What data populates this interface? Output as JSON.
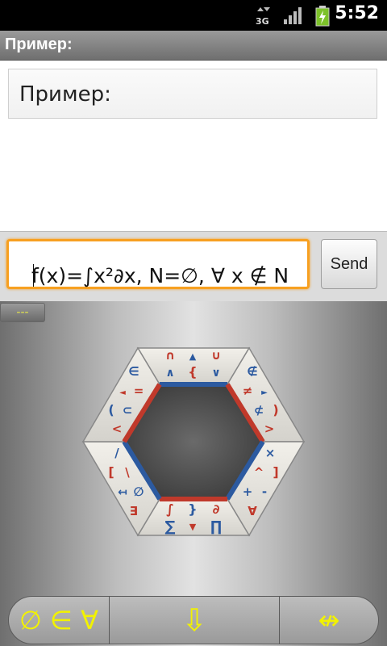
{
  "status_bar": {
    "network": "3G",
    "time": "5:52",
    "icons": [
      "network-3g-icon",
      "signal-icon",
      "battery-charging-icon"
    ]
  },
  "title_bar": {
    "title": "Пример:"
  },
  "preview": {
    "text": "Пример:"
  },
  "input": {
    "value": "f(x)=∫x²∂x, N=∅,  ∀ x ∉ N"
  },
  "send_button": {
    "label": "Send"
  },
  "mode_button": {
    "label": "---"
  },
  "hex_keys": {
    "top": [
      "∩",
      "▲",
      "∪",
      "∧",
      "{",
      "∨"
    ],
    "upper_right": [
      "∉",
      "≠",
      "►",
      "⊄",
      ")",
      ">"
    ],
    "lower_right": [
      "×",
      "^",
      "]",
      "+",
      "-",
      "∀"
    ],
    "bottom": [
      "∫",
      "}",
      "∂",
      "∑",
      "▼",
      "∏"
    ],
    "lower_left": [
      "/",
      "[",
      "\\",
      "↤",
      "∅",
      "∃"
    ],
    "upper_left": [
      "∈",
      "◄",
      "=",
      "(",
      "⊂",
      "<"
    ]
  },
  "bottom_bar": {
    "left_label": "∅ ∈ ∀",
    "middle_label": "⇩",
    "right_label": "↮"
  },
  "colors": {
    "key_red": "#c0392b",
    "key_blue": "#2c5aa0",
    "accent_yellow": "#f2f200",
    "focus_orange": "#f7a021"
  }
}
